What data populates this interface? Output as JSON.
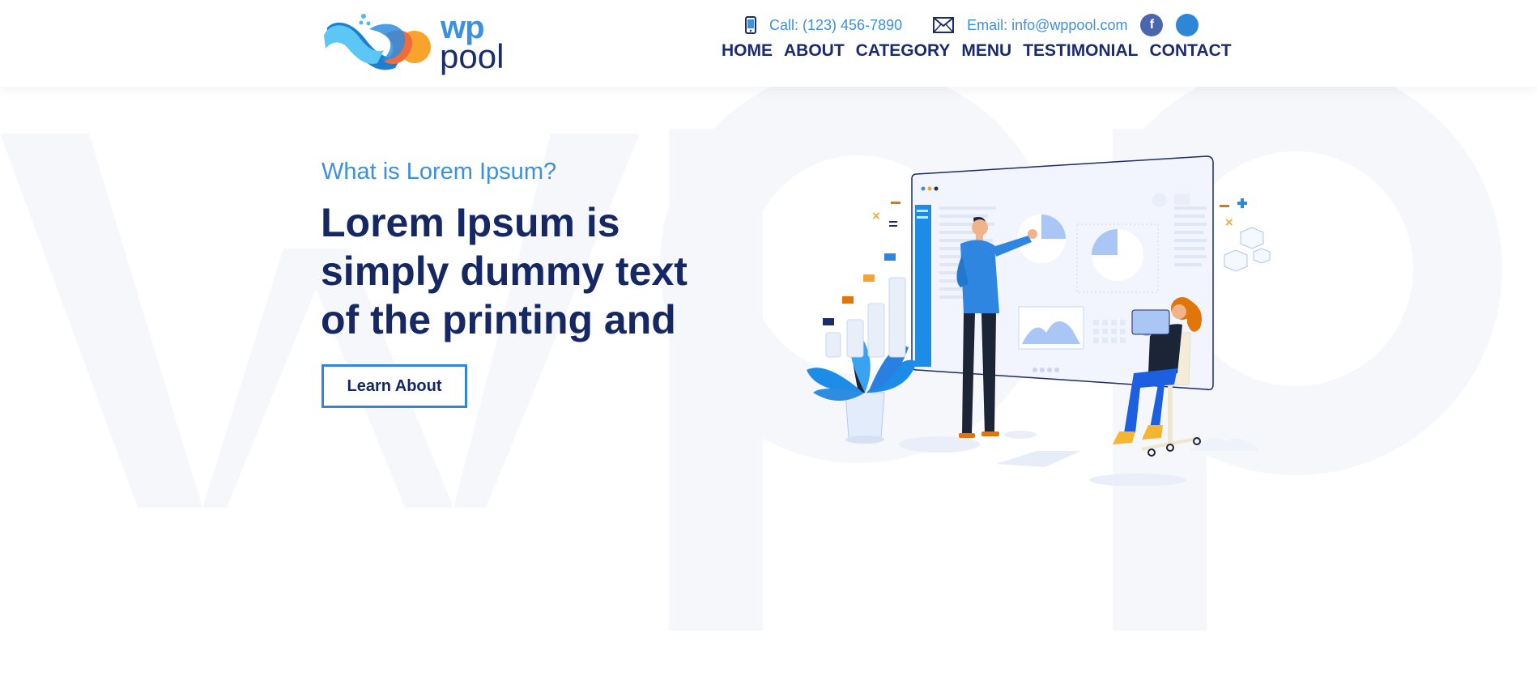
{
  "brand": {
    "wp": "wp",
    "pool": "pool"
  },
  "contact": {
    "phone_label": "Call: (123) 456-7890",
    "email_label": "Email: info@wppool.com",
    "social": [
      {
        "icon": "facebook-icon",
        "glyph": "f",
        "color": "#4a66ad"
      },
      {
        "icon": "social-icon",
        "glyph": "",
        "color": "#2e86d6"
      }
    ]
  },
  "nav": {
    "items": [
      "HOME",
      "ABOUT",
      "CATEGORY",
      "MENU",
      "TESTIMONIAL",
      "CONTACT"
    ]
  },
  "hero": {
    "subtitle": "What is Lorem Ipsum?",
    "title": "Lorem Ipsum is simply dummy text of the printing and",
    "button_label": "Learn About"
  },
  "colors": {
    "accent": "#3d8fe0",
    "heading": "#152864",
    "nav": "#1b2b6b",
    "button_border": "#2e86e0",
    "orange": "#f08a24"
  }
}
